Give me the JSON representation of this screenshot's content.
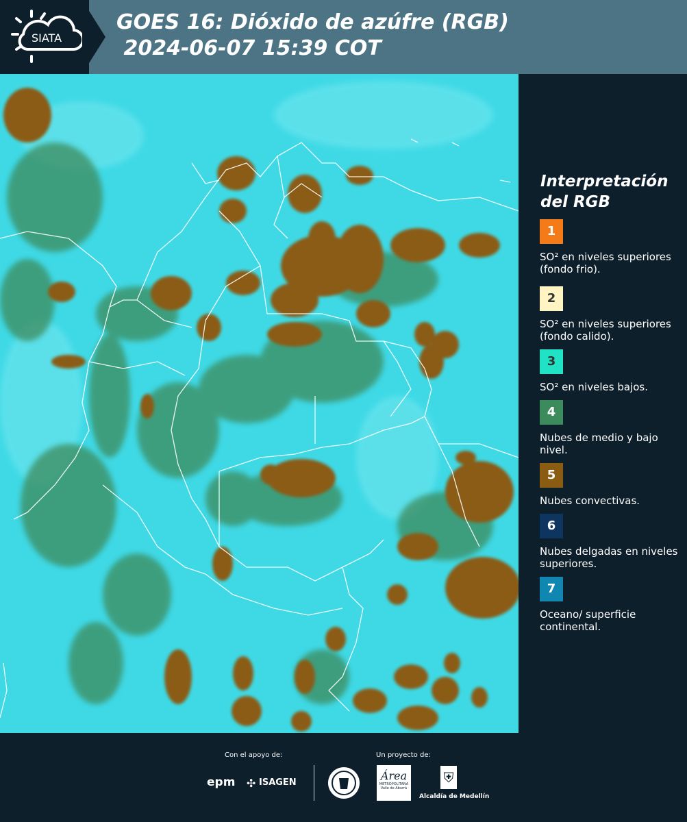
{
  "header": {
    "logo_text": "SIATA",
    "title": "GOES 16: Dióxido de azúfre (RGB)\n 2024-06-07 15:39 COT"
  },
  "legend": {
    "title": "Interpretación del RGB",
    "items": [
      {
        "number": "1",
        "label": "SO² en niveles superiores (fondo frio).",
        "color": "#f47b18"
      },
      {
        "number": "2",
        "label": "SO² en niveles superiores (fondo calido).",
        "color": "#fff4c2"
      },
      {
        "number": "3",
        "label": "SO² en niveles bajos.",
        "color": "#1fe3c4"
      },
      {
        "number": "4",
        "label": "Nubes de medio y bajo nivel.",
        "color": "#3c8b5c"
      },
      {
        "number": "5",
        "label": "Nubes convectivas.",
        "color": "#8a5c12"
      },
      {
        "number": "6",
        "label": "Nubes delgadas en niveles superiores.",
        "color": "#0d3560"
      },
      {
        "number": "7",
        "label": "Oceano/ superficie continental.",
        "color": "#0f87b0"
      }
    ]
  },
  "footer": {
    "support_label": "Con el apoyo de:",
    "project_label": "Un proyecto de:",
    "sponsor_epm": "epm",
    "sponsor_isagen": "ISAGEN",
    "area_text": "Área",
    "area_sub": "METROPOLITANA Valle de Aburrá",
    "alcaldia": "Alcaldía de Medellín"
  },
  "colors": {
    "background": "#0e1f2c",
    "header": "#4c7485",
    "ocean": "#3fd9e6",
    "convective": "#8a5c12",
    "low_cloud": "#3c8b5c"
  }
}
